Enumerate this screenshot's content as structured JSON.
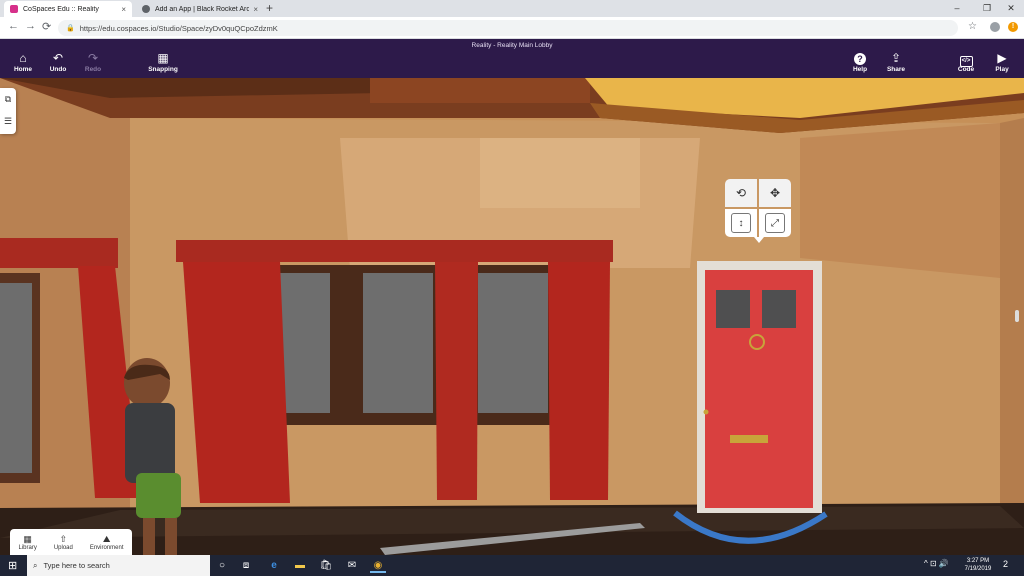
{
  "browser": {
    "tabs": [
      {
        "title": "CoSpaces Edu :: Reality",
        "close": "×",
        "active": true,
        "favicon_color": "#d6308a"
      },
      {
        "title": "Add an App | Black Rocket Arcad",
        "close": "×",
        "active": false,
        "favicon_color": "#5f6368"
      }
    ],
    "new_tab": "+",
    "window_controls": [
      "–",
      "❐",
      "✕"
    ],
    "nav": {
      "back": "←",
      "forward": "→",
      "reload": "⟳"
    },
    "url": "https://edu.cospaces.io/Studio/Space/zyDv0quQCpoZdzmK",
    "star_icon": "☆",
    "notification_badge": "!"
  },
  "app": {
    "scene_title": "Reality - Reality Main Lobby",
    "toolbar_left": [
      {
        "label": "Home",
        "icon": "⌂",
        "name": "home-button",
        "enabled": true
      },
      {
        "label": "Undo",
        "icon": "↶",
        "name": "undo-button",
        "enabled": true
      },
      {
        "label": "Redo",
        "icon": "↷",
        "name": "redo-button",
        "enabled": false
      },
      {
        "label": "Snapping",
        "icon": "▦",
        "name": "snapping-button",
        "enabled": true
      }
    ],
    "toolbar_right": [
      {
        "label": "Help",
        "icon": "?",
        "name": "help-button"
      },
      {
        "label": "Share",
        "icon": "⇪",
        "name": "share-button"
      },
      {
        "label": "Code",
        "icon": "</>",
        "name": "code-button"
      },
      {
        "label": "Play",
        "icon": "▶",
        "name": "play-button"
      }
    ],
    "side_tools": [
      {
        "icon": "⧉",
        "name": "gallery-icon"
      },
      {
        "icon": "☰",
        "name": "list-icon"
      }
    ],
    "gizmo": [
      {
        "icon": "⟲",
        "name": "rotate-mode-icon"
      },
      {
        "icon": "✥",
        "name": "move-mode-icon"
      },
      {
        "icon": "↕",
        "name": "lift-mode-icon"
      },
      {
        "icon": "⤢",
        "name": "scale-mode-icon"
      }
    ],
    "bottom_panel": [
      {
        "label": "Library",
        "icon": "▦",
        "name": "library-button"
      },
      {
        "label": "Upload",
        "icon": "⇧",
        "name": "upload-button"
      },
      {
        "label": "Environment",
        "icon": "⛰",
        "name": "environment-button"
      }
    ],
    "colors": {
      "toolbar": "#2d1a4a",
      "wall": "#c9955f",
      "door": "#d9403f",
      "curtain": "#b3261e",
      "selection_ring": "#3a78c8"
    }
  },
  "taskbar": {
    "start_icon": "⊞",
    "search_placeholder": "Type here to search",
    "search_icon": "⌕",
    "pinned": [
      {
        "icon": "○",
        "name": "cortana-icon"
      },
      {
        "icon": "⧈",
        "name": "task-view-icon"
      },
      {
        "icon": "e",
        "name": "edge-icon"
      },
      {
        "icon": "▬",
        "name": "file-explorer-icon"
      },
      {
        "icon": "🛍",
        "name": "store-icon"
      },
      {
        "icon": "✉",
        "name": "mail-icon"
      },
      {
        "icon": "◉",
        "name": "chrome-icon"
      }
    ],
    "tray": "^ ⊡ 🔊",
    "time": "3:27 PM",
    "date": "7/19/2019",
    "notifications": "2"
  }
}
